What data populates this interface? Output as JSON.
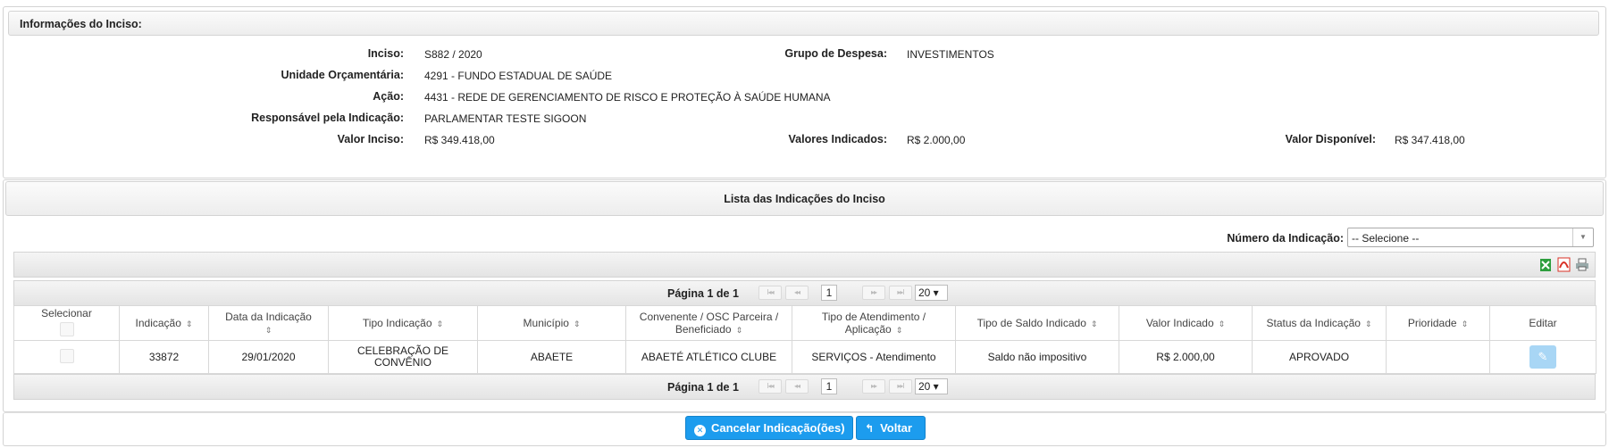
{
  "info": {
    "header": "Informações do Inciso:",
    "inciso_label": "Inciso:",
    "inciso_value": "S882 / 2020",
    "grupo_label": "Grupo de Despesa:",
    "grupo_value": "INVESTIMENTOS",
    "unidade_label": "Unidade Orçamentária:",
    "unidade_value": "4291 - FUNDO ESTADUAL DE SAÚDE",
    "acao_label": "Ação:",
    "acao_value": "4431 - REDE DE GERENCIAMENTO DE RISCO E PROTEÇÃO À SAÚDE HUMANA",
    "responsavel_label": "Responsável pela Indicação:",
    "responsavel_value": "PARLAMENTAR TESTE SIGOON",
    "valor_inciso_label": "Valor Inciso:",
    "valor_inciso_value": "R$ 349.418,00",
    "valores_indicados_label": "Valores Indicados:",
    "valores_indicados_value": "R$ 2.000,00",
    "valor_disponivel_label": "Valor Disponível:",
    "valor_disponivel_value": "R$ 347.418,00"
  },
  "list": {
    "header": "Lista das Indicações do Inciso",
    "filter_label": "Número da Indicação:",
    "filter_value": "-- Selecione --",
    "pager": {
      "text": "Página 1 de 1",
      "first": "I◂◂",
      "prev": "◂◂",
      "next": "▸▸",
      "last": "▸▸I",
      "current": "1",
      "page_size": "20 ▾"
    },
    "columns": [
      "Selecionar",
      "Indicação",
      "Data da Indicação",
      "Tipo Indicação",
      "Município",
      "Convenente / OSC Parceira / Beneficiado",
      "Tipo de Atendimento / Aplicação",
      "Tipo de Saldo Indicado",
      "Valor Indicado",
      "Status da Indicação",
      "Prioridade",
      "Editar"
    ],
    "rows": [
      {
        "indicacao": "33872",
        "data": "29/01/2020",
        "tipo": "CELEBRAÇÃO DE CONVÊNIO",
        "municipio": "ABAETE",
        "convenente": "ABAETÉ ATLÉTICO CLUBE",
        "atendimento": "SERVIÇOS - Atendimento",
        "saldo": "Saldo não impositivo",
        "valor": "R$ 2.000,00",
        "status": "APROVADO",
        "prioridade": ""
      }
    ]
  },
  "actions": {
    "cancel_label": "Cancelar Indicação(ões)",
    "back_label": "Voltar"
  },
  "colors": {
    "primary_button": "#1c9cee",
    "excel_icon": "#2e9e3e",
    "pdf_icon": "#d93025"
  },
  "icons": [
    "excel-export-icon",
    "pdf-export-icon",
    "print-icon",
    "sort-icon",
    "edit-icon",
    "cancel-circle-icon",
    "back-arrow-icon",
    "dropdown-arrow-icon"
  ]
}
